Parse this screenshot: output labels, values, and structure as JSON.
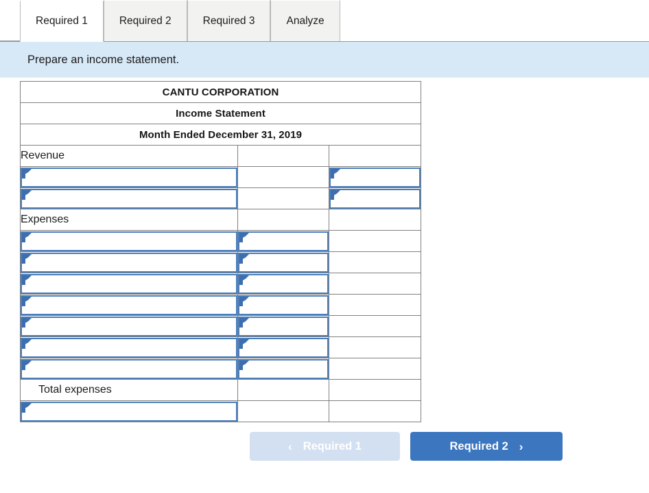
{
  "tabs": [
    {
      "label": "Required 1",
      "active": true
    },
    {
      "label": "Required 2",
      "active": false
    },
    {
      "label": "Required 3",
      "active": false
    },
    {
      "label": "Analyze",
      "active": false
    }
  ],
  "banner": {
    "instruction": "Prepare an income statement."
  },
  "statement": {
    "headers": [
      "CANTU CORPORATION",
      "Income Statement",
      "Month Ended December 31, 2019"
    ],
    "section_labels": {
      "revenue": "Revenue",
      "expenses": "Expenses",
      "total_expenses": "Total expenses"
    },
    "revenue_rows": [
      {
        "description": "",
        "amount_mid": "",
        "amount_right": ""
      },
      {
        "description": "",
        "amount_mid": "",
        "amount_right": ""
      }
    ],
    "expense_rows": [
      {
        "description": "",
        "amount_mid": ""
      },
      {
        "description": "",
        "amount_mid": ""
      },
      {
        "description": "",
        "amount_mid": ""
      },
      {
        "description": "",
        "amount_mid": ""
      },
      {
        "description": "",
        "amount_mid": ""
      },
      {
        "description": "",
        "amount_mid": ""
      },
      {
        "description": "",
        "amount_mid": ""
      }
    ],
    "total_expenses_row": {
      "amount_mid": "",
      "amount_right": ""
    },
    "net_income_row": {
      "description": "",
      "amount_mid": "",
      "amount_right": ""
    }
  },
  "navigation": {
    "prev_label": "Required 1",
    "next_label": "Required 2",
    "prev_icon": "chevron-left-icon",
    "next_icon": "chevron-right-icon",
    "prev_chevron": "‹",
    "next_chevron": "›",
    "prev_disabled": true
  },
  "colors": {
    "header_blue": "#79abe3",
    "banner_blue": "#d7e8f7",
    "field_border": "#4a7ebb",
    "field_marker": "#3d6fb0",
    "button_active": "#3b76bf",
    "button_disabled": "#d3e0f2",
    "grid_line": "#808080",
    "tab_inactive": "#f2f2f0"
  }
}
